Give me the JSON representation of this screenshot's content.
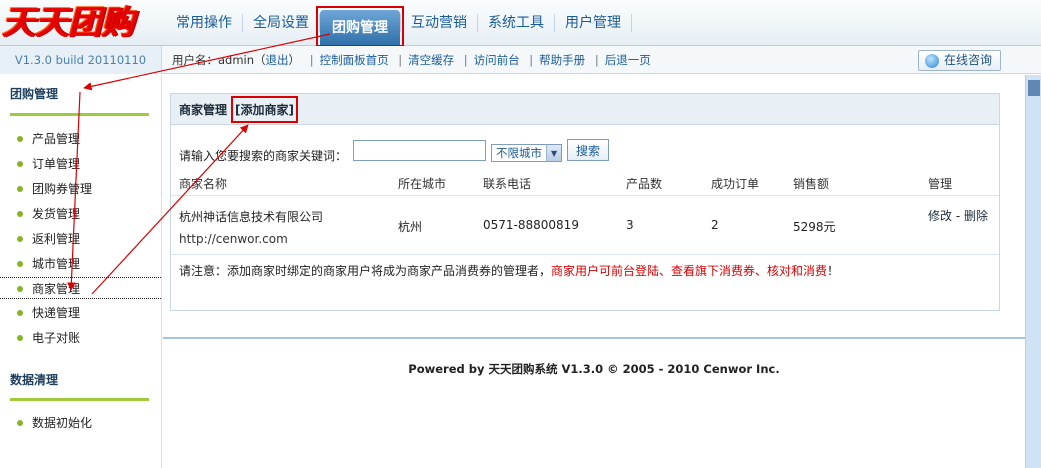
{
  "header": {
    "logo_text": "天天团购",
    "tabs": [
      {
        "label": "常用操作"
      },
      {
        "label": "全局设置"
      },
      {
        "label": "团购管理"
      },
      {
        "label": "互动营销"
      },
      {
        "label": "系统工具"
      },
      {
        "label": "用户管理"
      }
    ],
    "active_tab": "团购管理"
  },
  "subbar": {
    "version": "V1.3.0 build 20110110",
    "user_prefix": "用户名：admin（",
    "logout": "退出",
    "user_suffix": "）",
    "links": [
      "控制面板首页",
      "清空缓存",
      "访问前台",
      "帮助手册",
      "后退一页"
    ],
    "consult_button": "在线咨询"
  },
  "sidebar": {
    "section1_title": "团购管理",
    "items": [
      "产品管理",
      "订单管理",
      "团购券管理",
      "发货管理",
      "返利管理",
      "城市管理",
      "商家管理",
      "快递管理",
      "电子对账"
    ],
    "current_item": "商家管理",
    "section2_title": "数据清理",
    "items2": [
      "数据初始化"
    ]
  },
  "panel": {
    "title": "商家管理",
    "add_button": "[添加商家]",
    "search_label": "请输入您要搜索的商家关键词：",
    "search_value": "",
    "city_select": "不限城市",
    "search_button": "搜索",
    "table": {
      "headers": [
        "商家名称",
        "所在城市",
        "联系电话",
        "产品数",
        "成功订单",
        "销售额",
        "管理"
      ],
      "rows": [
        {
          "name": "杭州神话信息技术有限公司",
          "url": "http://cenwor.com",
          "city": "杭州",
          "phone": "0571-88800819",
          "products": "3",
          "orders": "2",
          "sales": "5298元",
          "edit": "修改",
          "dash": " - ",
          "delete": "删除"
        }
      ]
    },
    "note_prefix": "请注意：添加商家时绑定的商家用户将成为商家产品消费券的管理者，",
    "note_red": "商家用户可前台登陆、查看旗下消费券、核对和消费",
    "note_suffix": "！"
  },
  "footer": {
    "text": "Powered by 天天团购系统  V1.3.0 © 2005 - 2010 Cenwor Inc."
  },
  "colors": {
    "annotation": "#d80000",
    "link": "#1a5b98",
    "sidebar_bullet": "#85b525",
    "active_tab": "#2d6ea8"
  }
}
